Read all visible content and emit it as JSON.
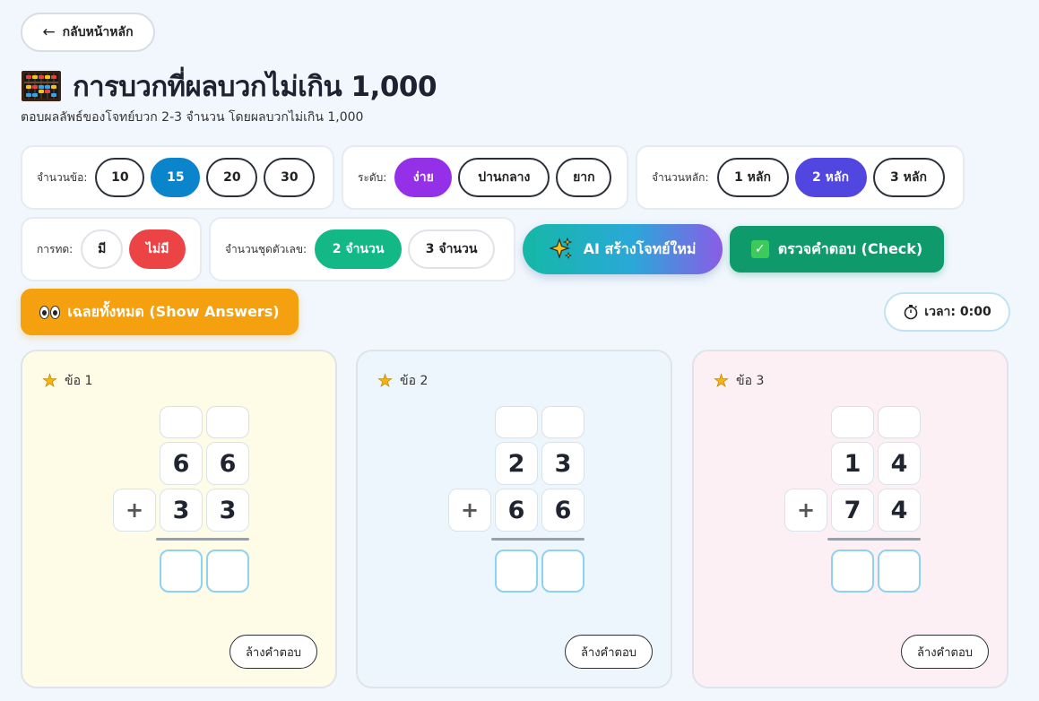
{
  "nav": {
    "back_label": "กลับหน้าหลัก"
  },
  "header": {
    "title": "การบวกที่ผลบวกไม่เกิน 1,000",
    "subtitle": "ตอบผลลัพธ์ของโจทย์บวก 2-3 จำนวน โดยผลบวกไม่เกิน 1,000",
    "icon": "abacus-icon"
  },
  "settings": {
    "count": {
      "label": "จำนวนข้อ:",
      "options": [
        "10",
        "15",
        "20",
        "30"
      ],
      "selected": "15"
    },
    "level": {
      "label": "ระดับ:",
      "options": [
        "ง่าย",
        "ปานกลาง",
        "ยาก"
      ],
      "selected": "ง่าย"
    },
    "digits": {
      "label": "จำนวนหลัก:",
      "options": [
        "1 หลัก",
        "2 หลัก",
        "3 หลัก"
      ],
      "selected": "2 หลัก"
    },
    "carry": {
      "label": "การทด:",
      "options": [
        "มี",
        "ไม่มี"
      ],
      "selected": "ไม่มี"
    },
    "sets": {
      "label": "จำนวนชุดตัวเลข:",
      "options": [
        "2 จำนวน",
        "3 จำนวน"
      ],
      "selected": "2 จำนวน"
    }
  },
  "actions": {
    "ai_label": "AI สร้างโจทย์ใหม่",
    "check_label": "ตรวจคำตอบ (Check)",
    "show_label": "เฉลยทั้งหมด (Show Answers)"
  },
  "timer": {
    "label": "เวลา: 0:00"
  },
  "problems": [
    {
      "title": "ข้อ 1",
      "top": [
        "6",
        "6"
      ],
      "operator": "+",
      "bottom": [
        "3",
        "3"
      ],
      "clear_label": "ล้างคำตอบ",
      "bg": "#fefbe6"
    },
    {
      "title": "ข้อ 2",
      "top": [
        "2",
        "3"
      ],
      "operator": "+",
      "bottom": [
        "6",
        "6"
      ],
      "clear_label": "ล้างคำตอบ",
      "bg": "#eef6fd"
    },
    {
      "title": "ข้อ 3",
      "top": [
        "1",
        "4"
      ],
      "operator": "+",
      "bottom": [
        "7",
        "4"
      ],
      "clear_label": "ล้างคำตอบ",
      "bg": "#fdf0f5"
    }
  ],
  "colors": {
    "selected_count": "#0a85cc",
    "selected_level": "#9430e8",
    "selected_digits": "#5146e0",
    "selected_carry": "#ec4444",
    "selected_sets": "#12b886",
    "check_button": "#0e9a6a",
    "show_button": "#f5a00e"
  }
}
